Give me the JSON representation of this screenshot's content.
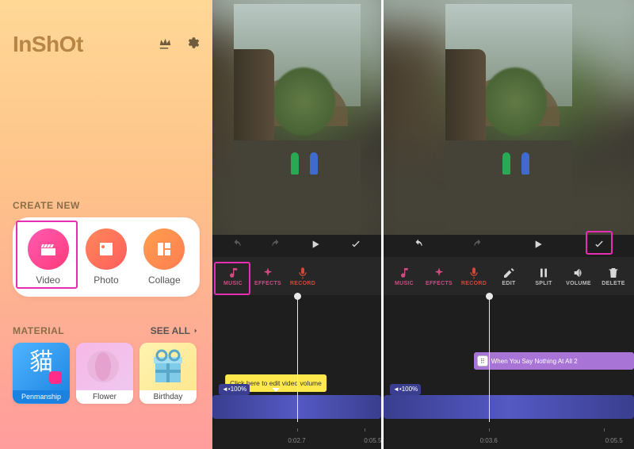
{
  "sidebar": {
    "logo": "InShOt",
    "create_title": "CREATE NEW",
    "create_items": [
      {
        "label": "Video"
      },
      {
        "label": "Photo"
      },
      {
        "label": "Collage"
      }
    ],
    "material_title": "MATERIAL",
    "see_all": "SEE ALL",
    "materials": [
      {
        "label": "Penmanship",
        "char": "貓"
      },
      {
        "label": "Flower"
      },
      {
        "label": "Birthday"
      }
    ]
  },
  "editor_left": {
    "tools": [
      {
        "label": "MUSIC"
      },
      {
        "label": "EFFECTS"
      },
      {
        "label": "RECORD"
      }
    ],
    "tip_text": "Click here to edit video volume",
    "vol_badge": "◄•100%",
    "tick_left": "0:02.7",
    "tick_right": "0:05.5"
  },
  "editor_right": {
    "tools": [
      {
        "label": "MUSIC"
      },
      {
        "label": "EFFECTS"
      },
      {
        "label": "RECORD"
      },
      {
        "label": "EDIT"
      },
      {
        "label": "SPLIT"
      },
      {
        "label": "VOLUME"
      },
      {
        "label": "DELETE"
      }
    ],
    "audio_title": "When You Say Nothing At All 2",
    "vol_badge": "◄•100%",
    "tick_left": "0:03.6",
    "tick_right": "0:05.5"
  }
}
